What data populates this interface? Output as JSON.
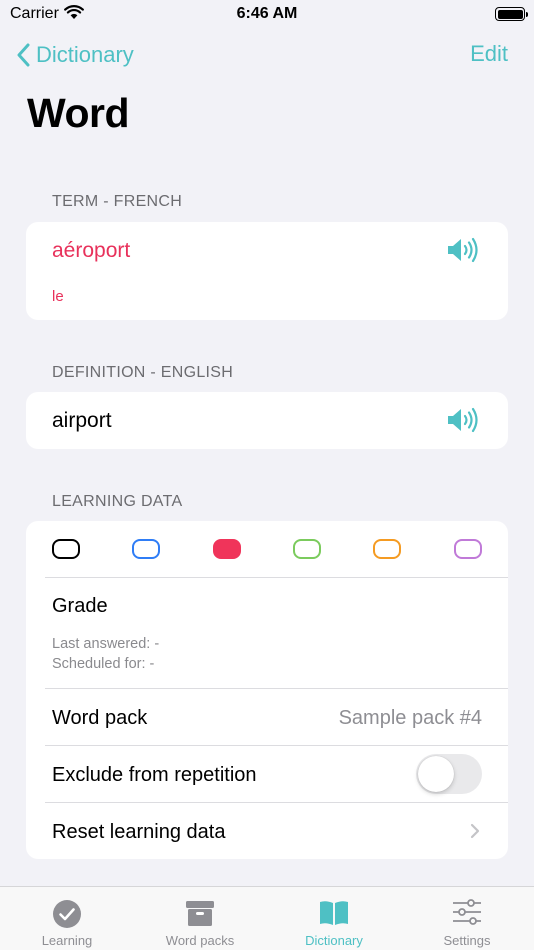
{
  "status": {
    "carrier": "Carrier",
    "time": "6:46 AM"
  },
  "nav": {
    "back_label": "Dictionary",
    "edit_label": "Edit",
    "title": "Word"
  },
  "term": {
    "header": "TERM - FRENCH",
    "word": "aéroport",
    "article": "le",
    "speaker_icon": "speaker-icon"
  },
  "definition": {
    "header": "DEFINITION - ENGLISH",
    "text": "airport",
    "speaker_icon": "speaker-icon"
  },
  "learning": {
    "header": "LEARNING DATA",
    "colors": [
      {
        "name": "black",
        "hex": "#000000",
        "selected": false
      },
      {
        "name": "blue",
        "hex": "#2f7df6",
        "selected": false
      },
      {
        "name": "red",
        "hex": "#f0345a",
        "selected": true
      },
      {
        "name": "green",
        "hex": "#7bcb5d",
        "selected": false
      },
      {
        "name": "orange",
        "hex": "#f59b22",
        "selected": false
      },
      {
        "name": "purple",
        "hex": "#c07ad8",
        "selected": false
      }
    ],
    "grade_label": "Grade",
    "last_answered": "Last answered: -",
    "scheduled_for": "Scheduled for: -",
    "word_pack_label": "Word pack",
    "word_pack_value": "Sample pack #4",
    "exclude_label": "Exclude from repetition",
    "exclude_on": false,
    "reset_label": "Reset learning data"
  },
  "tabs": [
    {
      "label": "Learning",
      "icon": "checkmark-circle-icon",
      "active": false
    },
    {
      "label": "Word packs",
      "icon": "archive-box-icon",
      "active": false
    },
    {
      "label": "Dictionary",
      "icon": "book-icon",
      "active": true
    },
    {
      "label": "Settings",
      "icon": "sliders-icon",
      "active": false
    }
  ],
  "colors": {
    "accent": "#4ec0c4",
    "term": "#e8315b",
    "background": "#f2f2f7"
  }
}
